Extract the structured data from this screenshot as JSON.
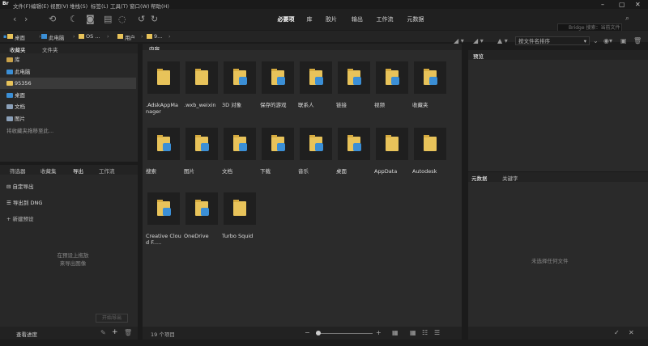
{
  "menu": [
    "文件(F)",
    "编辑(E)",
    "视图(V)",
    "堆栈(S)",
    "标签(L)",
    "工具(T)",
    "窗口(W)",
    "帮助(H)"
  ],
  "workspaces": {
    "active": "必要项",
    "items": [
      "库",
      "胶片",
      "输出",
      "工作流",
      "元数据"
    ]
  },
  "search": {
    "placeholder": "Bridge 搜索：当前文件"
  },
  "breadcrumb": [
    "桌面",
    "此电脑",
    "OS ...",
    "用户",
    "9..."
  ],
  "sort": {
    "label": "按文件名排序"
  },
  "left_top": {
    "tabs": [
      "收藏夹",
      "文件夹"
    ],
    "items": [
      {
        "label": "库",
        "color": "#c9a24a"
      },
      {
        "label": "此电脑",
        "color": "#3b8fd6"
      },
      {
        "label": "95356",
        "color": "#e8c35a"
      },
      {
        "label": "桌面",
        "color": "#3b8fd6"
      },
      {
        "label": "文档",
        "color": "#8ba0b8"
      },
      {
        "label": "图片",
        "color": "#8ba0b8"
      }
    ],
    "hint": "将收藏夹拖移至此..."
  },
  "left_bottom": {
    "tabs": [
      "筛选器",
      "收藏集",
      "导出",
      "工作流"
    ],
    "items": [
      "自定导出",
      "导出到 DNG",
      "新建预设"
    ],
    "hint": [
      "在预设上拖放",
      "来导出图像"
    ],
    "button": "开始导出",
    "footer": "查看进度"
  },
  "content": {
    "tab": "内容",
    "items": [
      {
        "label": ".AdskAppManager",
        "badge": false
      },
      {
        "label": ".wxb_weixin",
        "badge": false
      },
      {
        "label": "3D 对象",
        "badge": true
      },
      {
        "label": "保存的游戏",
        "badge": true
      },
      {
        "label": "联系人",
        "badge": true
      },
      {
        "label": "链接",
        "badge": true
      },
      {
        "label": "视频",
        "badge": true
      },
      {
        "label": "收藏夹",
        "badge": true
      },
      {
        "label": "搜索",
        "badge": true
      },
      {
        "label": "图片",
        "badge": true
      },
      {
        "label": "文档",
        "badge": true
      },
      {
        "label": "下载",
        "badge": true
      },
      {
        "label": "音乐",
        "badge": true
      },
      {
        "label": "桌面",
        "badge": true
      },
      {
        "label": "AppData",
        "badge": false
      },
      {
        "label": "Autodesk",
        "badge": false
      },
      {
        "label": "Creative Cloud F.....",
        "badge": true
      },
      {
        "label": "OneDrive",
        "badge": true
      },
      {
        "label": "Turbo Squid",
        "badge": false
      }
    ]
  },
  "status": {
    "count": "19 个项目"
  },
  "right": {
    "preview_tab": "预览",
    "meta_tabs": [
      "元数据",
      "关键字"
    ],
    "empty": "未选择任何文件"
  }
}
